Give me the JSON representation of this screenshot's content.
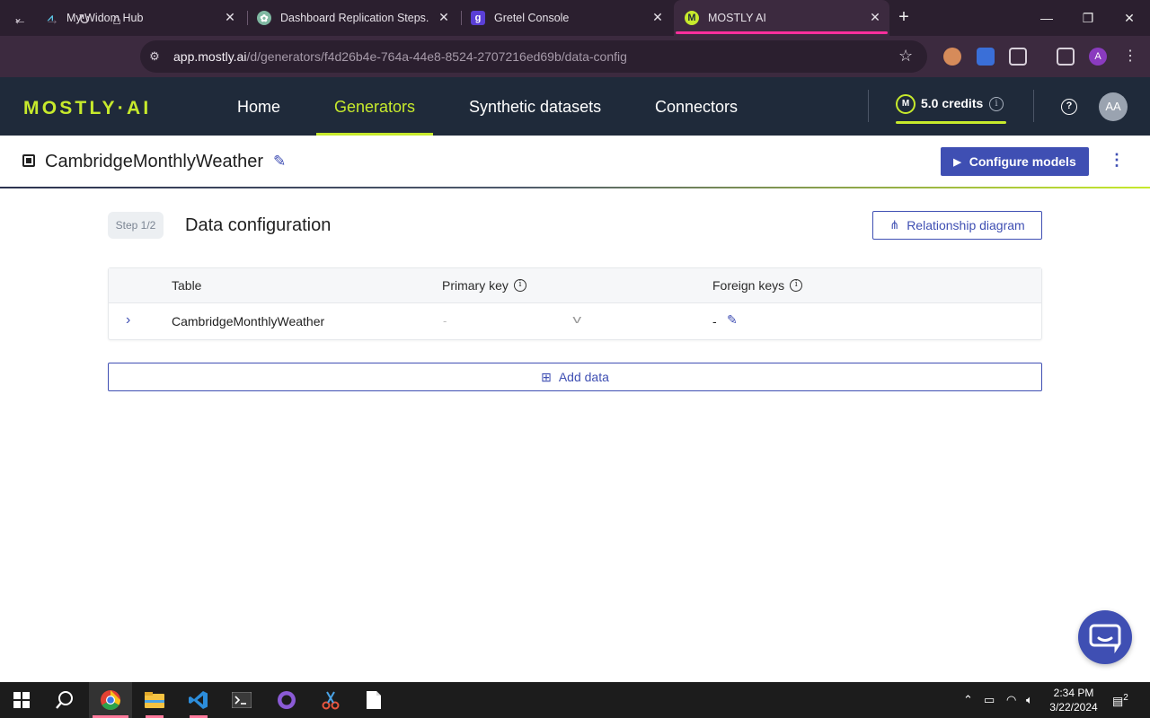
{
  "browser": {
    "tabs": [
      {
        "title": "My Widom Hub",
        "favicon": "widom-hub-icon",
        "active": false
      },
      {
        "title": "Dashboard Replication Steps.",
        "favicon": "chatgpt-icon",
        "active": false
      },
      {
        "title": "Gretel Console",
        "favicon": "gretel-icon",
        "active": false
      },
      {
        "title": "MOSTLY AI",
        "favicon": "mostly-ai-icon",
        "active": true
      }
    ],
    "url_host": "app.mostly.ai",
    "url_path": "/d/generators/f4d26b4e-764a-44e8-8524-2707216ed69b/data-config",
    "profile_initial": "A"
  },
  "app": {
    "logo": "MOSTLY·AI",
    "nav": [
      {
        "label": "Home",
        "active": false
      },
      {
        "label": "Generators",
        "active": true
      },
      {
        "label": "Synthetic datasets",
        "active": false
      },
      {
        "label": "Connectors",
        "active": false
      }
    ],
    "credits_badge": "M",
    "credits": "5.0 credits",
    "avatar": "AA",
    "accent_color": "#c7ea2c",
    "primary_color": "#3f4fb3",
    "nav_bg_color": "#1f2a3a"
  },
  "generator": {
    "name": "CambridgeMonthlyWeather",
    "configure_label": "Configure models"
  },
  "config": {
    "step": "Step 1/2",
    "title": "Data configuration",
    "relationship_label": "Relationship diagram",
    "columns": {
      "table": "Table",
      "primary_key": "Primary key",
      "foreign_keys": "Foreign keys"
    },
    "rows": [
      {
        "table": "CambridgeMonthlyWeather",
        "primary_key": "-",
        "foreign_keys": "-"
      }
    ],
    "add_data_label": "Add data"
  },
  "taskbar": {
    "time": "2:34 PM",
    "date": "3/22/2024",
    "notifications": "2"
  }
}
